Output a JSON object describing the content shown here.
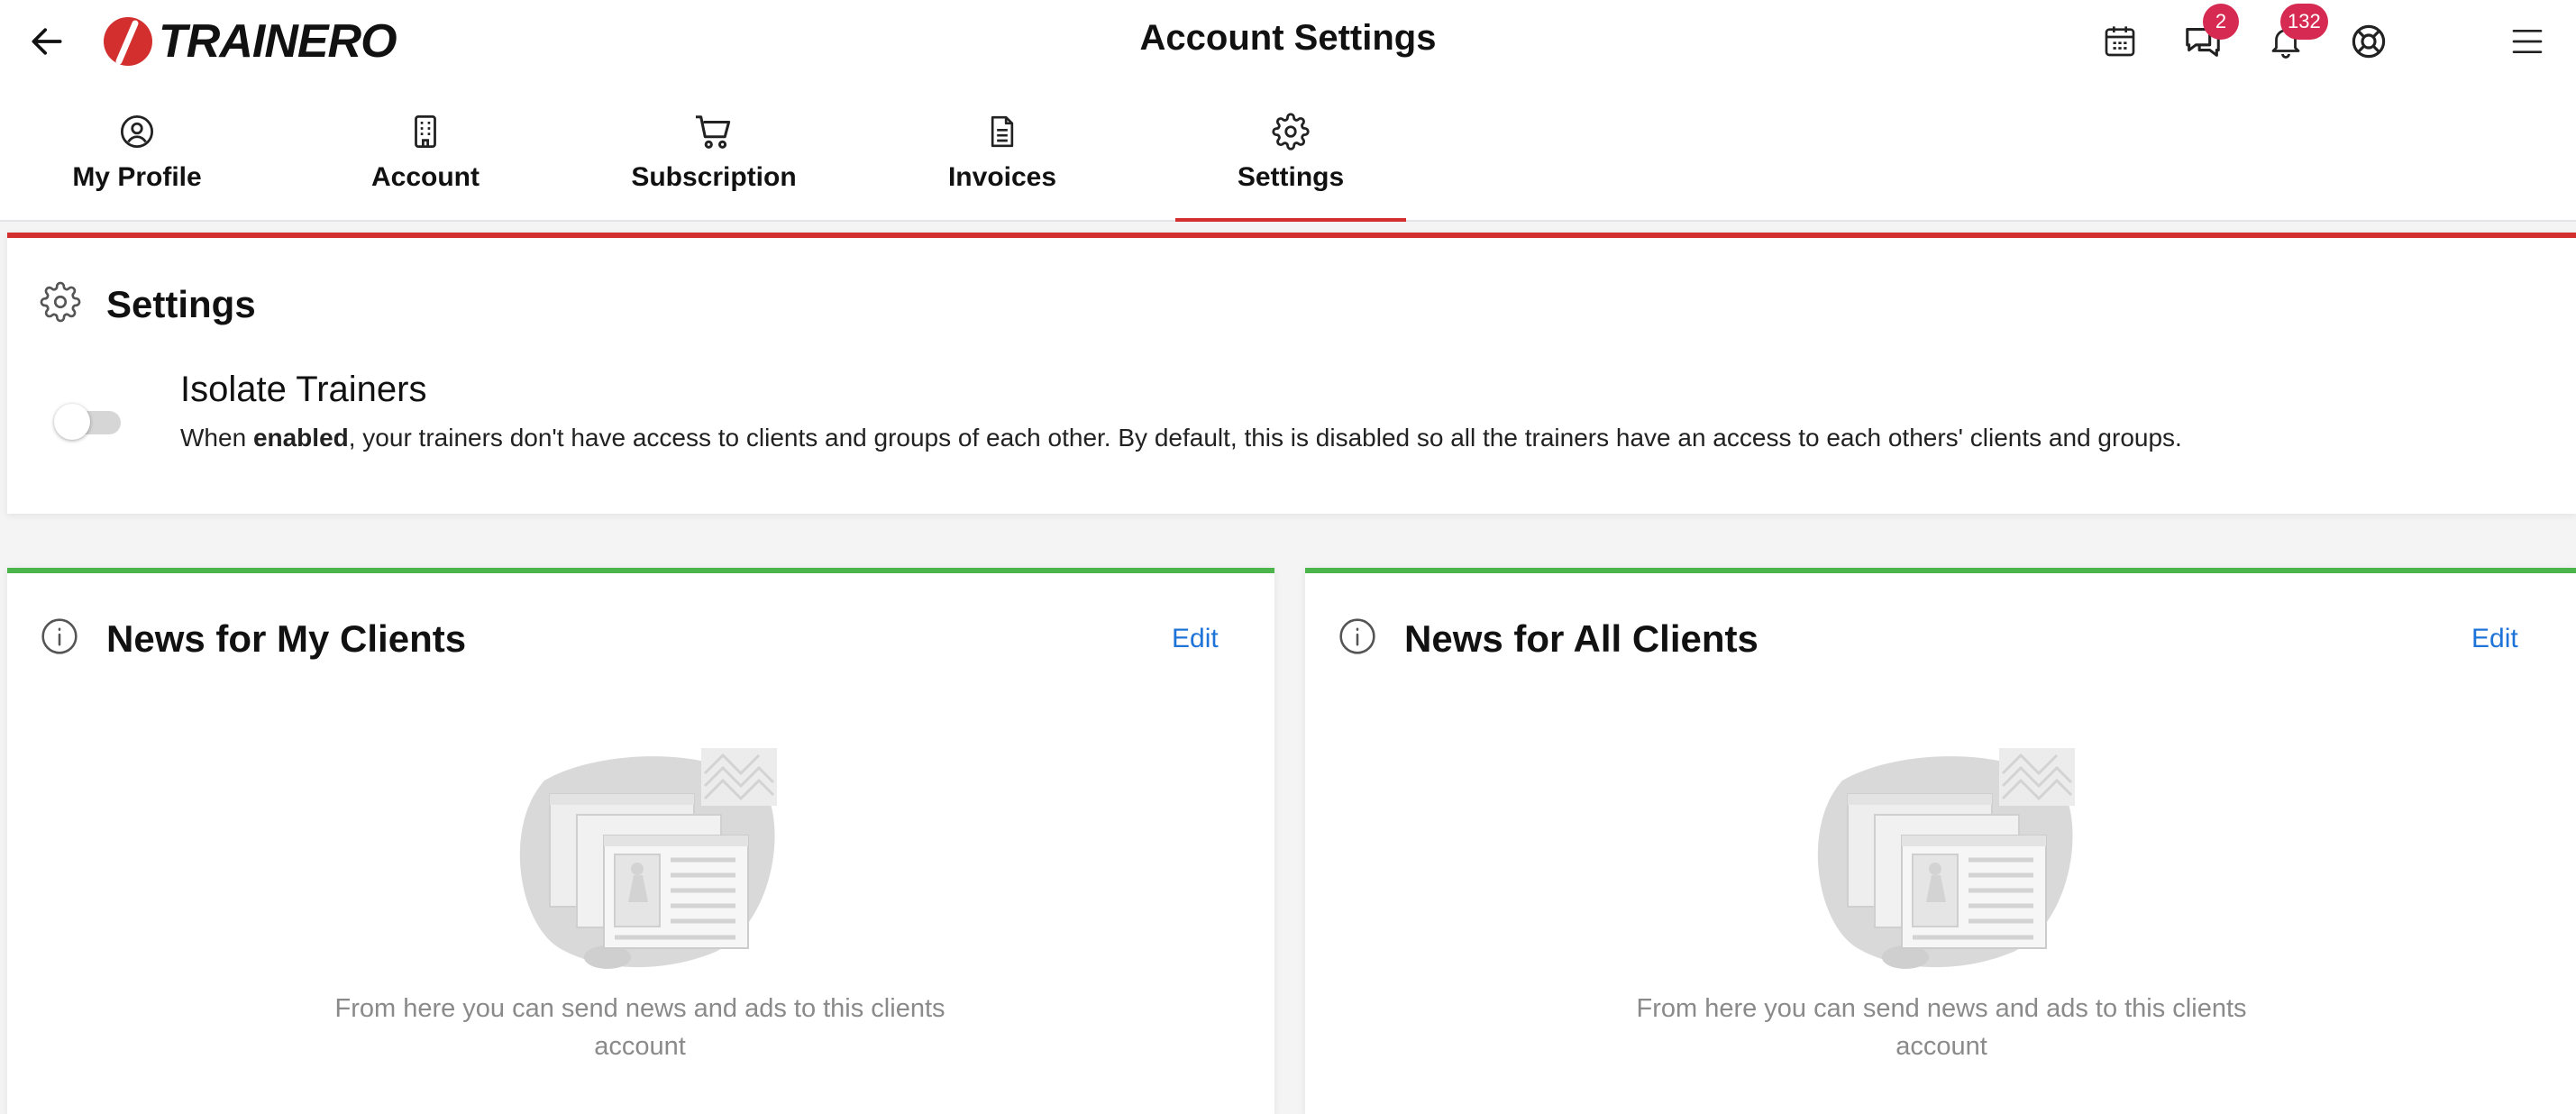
{
  "header": {
    "title": "Account Settings",
    "logo_text": "TRAINERO",
    "messages_badge": "2",
    "notifications_badge": "132"
  },
  "tabs": [
    {
      "label": "My Profile",
      "icon": "user-circle-icon"
    },
    {
      "label": "Account",
      "icon": "building-icon"
    },
    {
      "label": "Subscription",
      "icon": "cart-icon"
    },
    {
      "label": "Invoices",
      "icon": "document-icon"
    },
    {
      "label": "Settings",
      "icon": "gear-icon",
      "active": true
    }
  ],
  "settings_card": {
    "title": "Settings",
    "option": {
      "title": "Isolate Trainers",
      "desc_before": "When ",
      "desc_bold": "enabled",
      "desc_after": ", your trainers don't have access to clients and groups of each other. By default, this is disabled so all the trainers have an access to each others' clients and groups.",
      "enabled": false
    }
  },
  "news_my": {
    "title": "News for My Clients",
    "edit": "Edit",
    "empty_text": "From here you can send news and ads to this clients account"
  },
  "news_all": {
    "title": "News for All Clients",
    "edit": "Edit",
    "empty_text": "From here you can send news and ads to this clients account"
  },
  "colors": {
    "accent_red": "#d42f2f",
    "accent_green": "#4bb54c",
    "link_blue": "#1e73d9",
    "badge": "#d62a52"
  }
}
